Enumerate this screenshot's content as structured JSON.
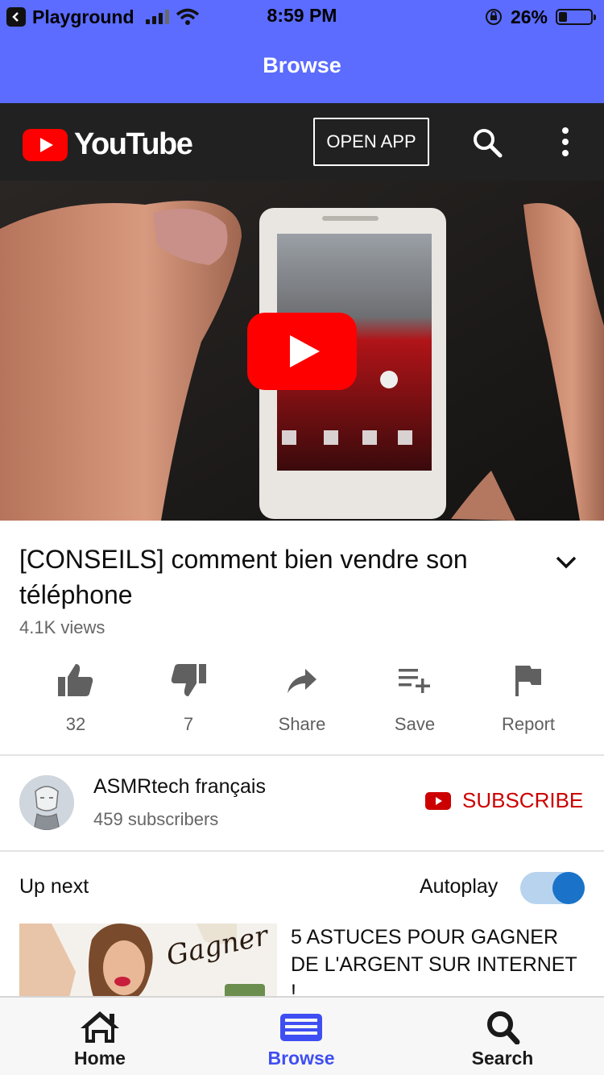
{
  "status_bar": {
    "back_app": "Playground",
    "time": "8:59 PM",
    "battery": "26%",
    "battery_level": 0.26
  },
  "nav": {
    "title": "Browse"
  },
  "youtube_header": {
    "logo_text": "YouTube",
    "open_app_label": "OPEN APP",
    "icons": [
      "search-icon",
      "more-vertical-icon"
    ]
  },
  "video": {
    "title": "[CONSEILS] comment bien vendre son téléphone",
    "views": "4.1K views"
  },
  "actions": [
    {
      "icon": "thumbs-up-icon",
      "label": "32"
    },
    {
      "icon": "thumbs-down-icon",
      "label": "7"
    },
    {
      "icon": "share-icon",
      "label": "Share"
    },
    {
      "icon": "playlist-add-icon",
      "label": "Save"
    },
    {
      "icon": "flag-icon",
      "label": "Report"
    }
  ],
  "channel": {
    "name": "ASMRtech français",
    "subscribers": "459 subscribers",
    "subscribe_label": "SUBSCRIBE"
  },
  "up_next": {
    "heading": "Up next",
    "autoplay_label": "Autoplay",
    "autoplay_on": true,
    "next_video_title": "5 ASTUCES POUR GAGNER DE L'ARGENT SUR INTERNET !",
    "thumb_text": "Gagner"
  },
  "tabbar": {
    "items": [
      {
        "label": "Home",
        "icon": "home-icon",
        "active": false
      },
      {
        "label": "Browse",
        "icon": "browse-icon",
        "active": true
      },
      {
        "label": "Search",
        "icon": "search-icon",
        "active": false
      }
    ]
  },
  "colors": {
    "ios_nav": "#5b6cff",
    "youtube_red": "#ff0000",
    "subscribe_red": "#cc0000",
    "youtube_bar": "#212121",
    "tab_active": "#3f4ef2",
    "tab_inactive": "#1a1a1a"
  }
}
